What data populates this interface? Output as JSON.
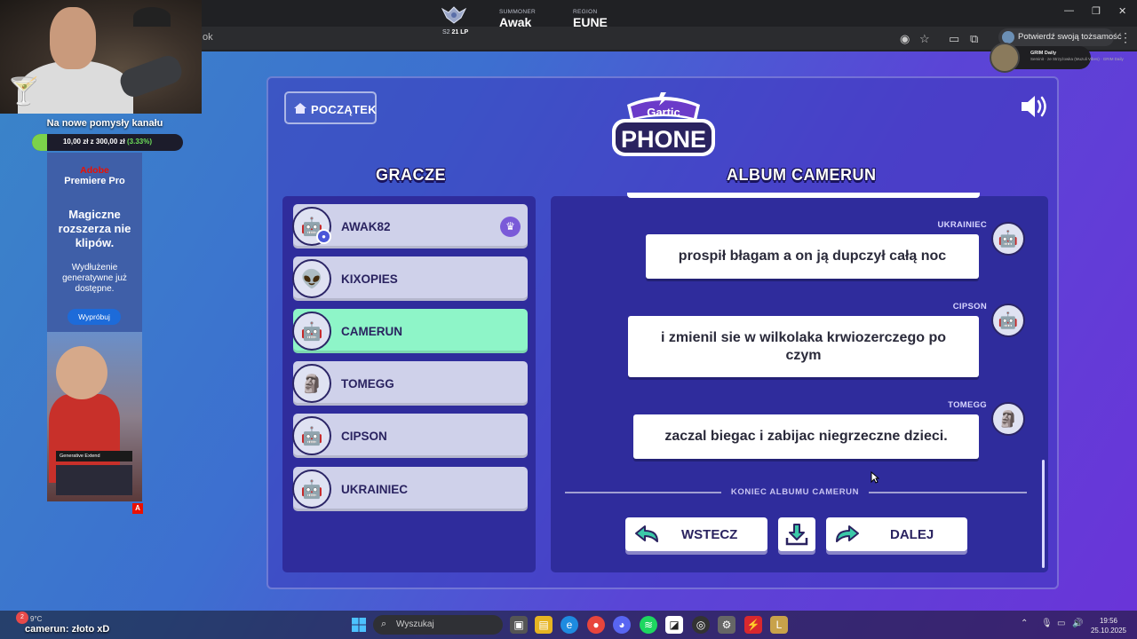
{
  "browser": {
    "url_fragment": "ok",
    "verify_label": "Potwierdź swoją tożsamość",
    "yt_card_title": "GRIM Daily",
    "yt_card_sub": "Seminit · ze Strzyżowka (Muzuli Vibes) · GRIM Daily"
  },
  "lol_overlay": {
    "lp_prefix": "S2",
    "lp_value": "21 LP",
    "summoner_label": "SUMMONER",
    "summoner_value": "Awak",
    "region_label": "REGION",
    "region_value": "EUNE"
  },
  "donation": {
    "title": "Na nowe pomysły kanału",
    "amount_text": "10,00 zł z 300,00 zł",
    "percent_text": "(3.33%)",
    "progress_fraction": 0.0333
  },
  "ad": {
    "logo": "Adobe",
    "product": "Premiere Pro",
    "headline": "Magiczne rozszerza nie klipów.",
    "subline": "Wydłużenie generatywne już dostępne.",
    "button": "Wypróbuj",
    "tag": "Generative Extend",
    "badge": "A"
  },
  "game": {
    "home_button": "POCZĄTEK",
    "players_title": "GRACZE",
    "album_title": "ALBUM CAMERUN",
    "players": [
      {
        "name": "AWAK82",
        "icon": "robot-green-icon",
        "host": true,
        "active": false
      },
      {
        "name": "KIXOPIES",
        "icon": "alien-icon",
        "host": false,
        "active": false
      },
      {
        "name": "CAMERUN",
        "icon": "pink-robot-icon",
        "host": false,
        "active": true
      },
      {
        "name": "TOMEGG",
        "icon": "tiki-mask-icon",
        "host": false,
        "active": false
      },
      {
        "name": "CIPSON",
        "icon": "robot-helmet-icon",
        "host": false,
        "active": false
      },
      {
        "name": "UKRAINIEC",
        "icon": "robot-round-icon",
        "host": false,
        "active": false
      }
    ],
    "album": [
      {
        "author": "UKRAINIEC",
        "text": "prospił błagam a on ją dupczył całą noc"
      },
      {
        "author": "CIPSON",
        "text": "i zmienil sie w wilkolaka krwiozerczego po czym"
      },
      {
        "author": "TOMEGG",
        "text": "zaczal biegac i zabijac niegrzeczne dzieci."
      }
    ],
    "end_label": "KONIEC ALBUMU CAMERUN",
    "back_button": "WSTECZ",
    "next_button": "DALEJ"
  },
  "taskbar": {
    "chat_badge": "2",
    "weather": "9°C",
    "chat_user": "camerun",
    "chat_text": ": złoto xD",
    "search_placeholder": "Wyszukaj",
    "time": "19:56",
    "date": "25.10.2025"
  },
  "colors": {
    "player_row": "#cfd1ea",
    "player_active": "#8ef5c8",
    "panel_inner": "#2f2c9c",
    "accent_purple": "#7a5ad8"
  }
}
